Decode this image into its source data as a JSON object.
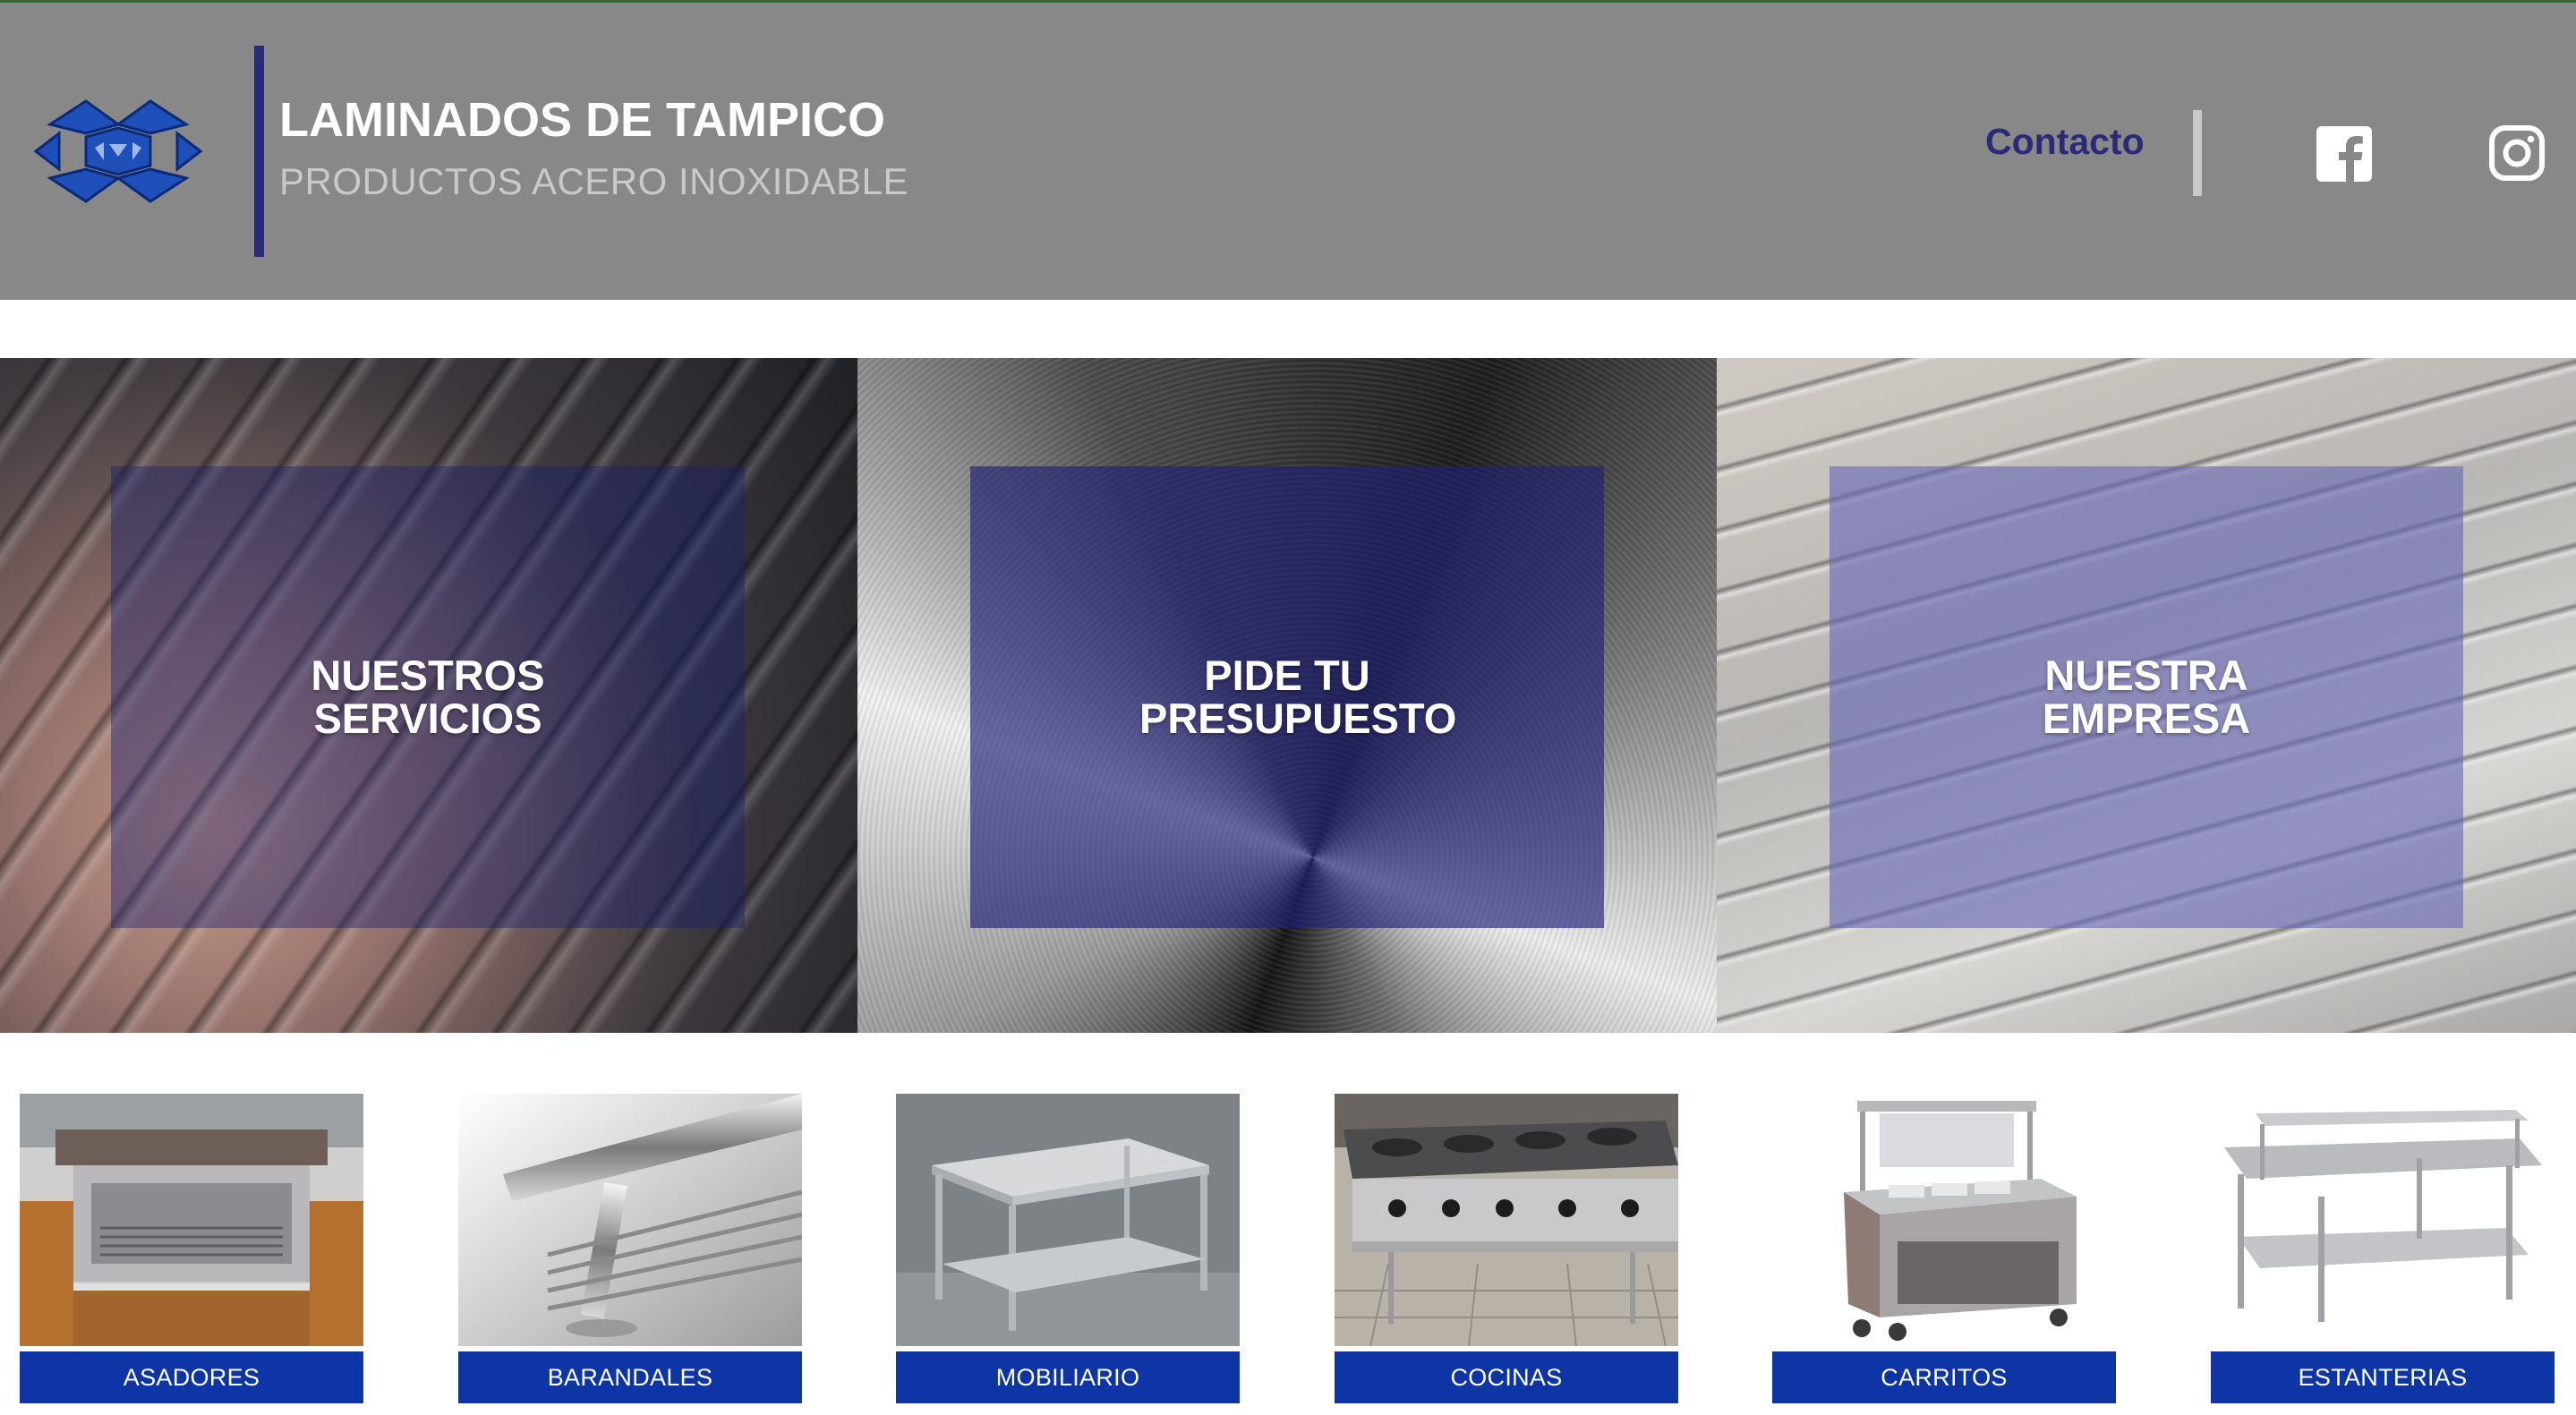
{
  "header": {
    "title": "LAMINADOS DE TAMPICO",
    "subtitle": "PRODUCTOS ACERO INOXIDABLE",
    "contact_label": "Contacto",
    "social": [
      {
        "icon": "facebook-icon"
      },
      {
        "icon": "instagram-icon"
      }
    ]
  },
  "hero": {
    "panels": [
      {
        "label": "NUESTROS SERVICIOS"
      },
      {
        "label": "PIDE TU PRESUPUESTO"
      },
      {
        "label": "NUESTRA EMPRESA"
      }
    ]
  },
  "products": [
    {
      "label": "ASADORES"
    },
    {
      "label": "BARANDALES"
    },
    {
      "label": "MOBILIARIO"
    },
    {
      "label": "COCINAS"
    },
    {
      "label": "CARRITOS"
    },
    {
      "label": "ESTANTERIAS"
    }
  ],
  "colors": {
    "header_bg": "#888888",
    "brand_navy": "#2a2b78",
    "button_blue": "#0e35a6"
  }
}
